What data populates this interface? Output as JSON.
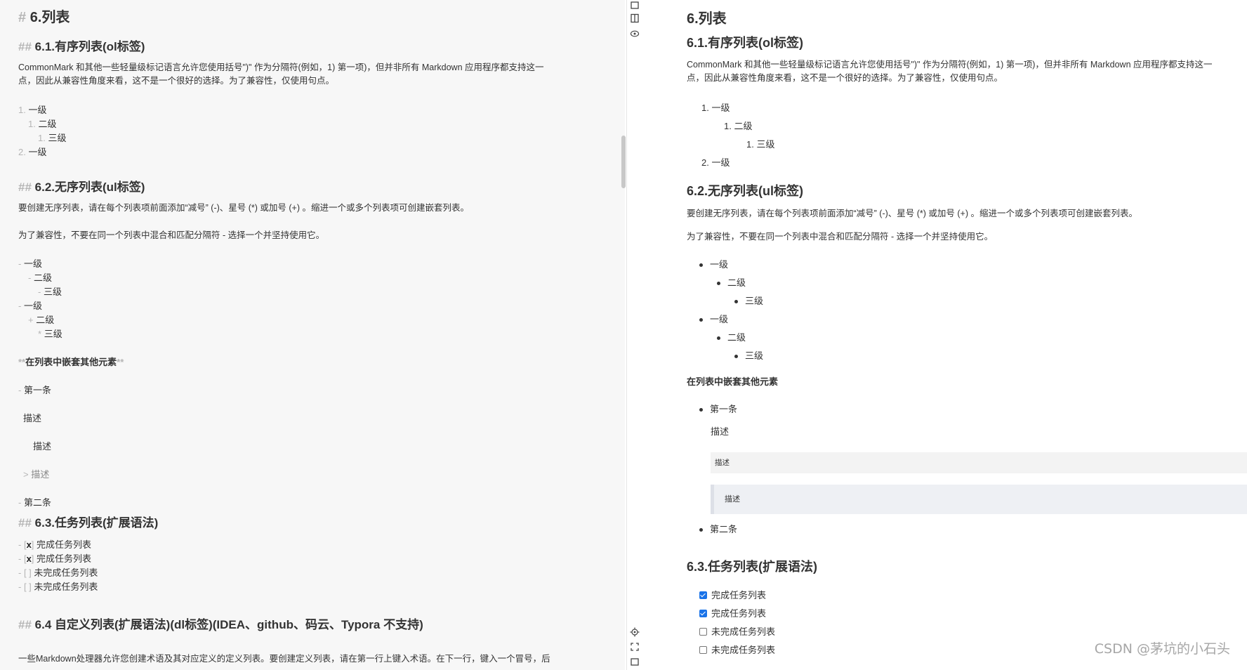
{
  "editor": {
    "h1": {
      "mark": "#",
      "text": "6.列表"
    },
    "h2_ol": {
      "mark": "##",
      "text": "6.1.有序列表(ol标签)"
    },
    "ol_para_1": "CommonMark 和其他一些轻量级标记语言允许您使用括号\")\" 作为分隔符(例如，1) 第一项)，但并非所有 Markdown 应用程序都支持这一",
    "ol_para_2": "点，因此从兼容性角度来看，这不是一个很好的选择。为了兼容性，仅使用句点。",
    "ol_items": [
      {
        "mark": "1.",
        "text": "一级"
      },
      {
        "mark": "1.",
        "text": "二级"
      },
      {
        "mark": "1.",
        "text": "三级"
      },
      {
        "mark": "2.",
        "text": "一级"
      }
    ],
    "h2_ul": {
      "mark": "##",
      "text": "6.2.无序列表(ul标签)"
    },
    "ul_para_1": "要创建无序列表，请在每个列表项前面添加“减号” (-)、星号 (*) 或加号 (+) 。缩进一个或多个列表项可创建嵌套列表。",
    "ul_para_2": "为了兼容性，不要在同一个列表中混合和匹配分隔符 - 选择一个并坚持使用它。",
    "ul_items": [
      {
        "mark": "-",
        "text": "一级"
      },
      {
        "mark": "-",
        "text": "二级"
      },
      {
        "mark": "-",
        "text": "三级"
      },
      {
        "mark": "-",
        "text": "一级"
      },
      {
        "mark": "+",
        "text": "二级"
      },
      {
        "mark": "*",
        "text": "三级"
      }
    ],
    "nested_title": {
      "mark_open": "**",
      "text": "在列表中嵌套其他元素",
      "mark_close": "**"
    },
    "nested_item_1": {
      "mark": "-",
      "text": "第一条"
    },
    "desc_1": "描述",
    "desc_2": "描述",
    "desc_3": {
      "mark": ">",
      "text": "描述"
    },
    "nested_item_2": {
      "mark": "-",
      "text": "第二条"
    },
    "h2_task": {
      "mark": "##",
      "text": "6.3.任务列表(扩展语法)"
    },
    "tasks": [
      {
        "open": "- [",
        "x": "x",
        "close": "]",
        "text": "完成任务列表"
      },
      {
        "open": "- [",
        "x": "x",
        "close": "]",
        "text": "完成任务列表"
      },
      {
        "open": "- [ ]",
        "x": "",
        "close": "",
        "text": "未完成任务列表"
      },
      {
        "open": "- [ ]",
        "x": "",
        "close": "",
        "text": "未完成任务列表"
      }
    ],
    "h2_dl": {
      "mark": "##",
      "text": "6.4 自定义列表(扩展语法)(dl标签)(IDEA、github、码云、Typora 不支持)"
    },
    "dl_para": "一些Markdown处理器允许您创建术语及其对应定义的定义列表。要创建定义列表，请在第一行上键入术语。在下一行，键入一个冒号，后"
  },
  "strip_icons": [
    "editor-only-icon",
    "split-view-icon",
    "preview-icon",
    "locate-icon",
    "fullscreen-icon",
    "bottom-panel-icon"
  ],
  "preview": {
    "h1": "6.列表",
    "h2_ol": "6.1.有序列表(ol标签)",
    "ol_para_1": "CommonMark 和其他一些轻量级标记语言允许您使用括号\")\" 作为分隔符(例如，1) 第一项)，但并非所有 Markdown 应用程序都支持这一",
    "ol_para_2": "点，因此从兼容性角度来看，这不是一个很好的选择。为了兼容性，仅使用句点。",
    "ol_items": [
      {
        "num": "1.",
        "text": "一级"
      },
      {
        "num": "1.",
        "text": "二级"
      },
      {
        "num": "1.",
        "text": "三级"
      },
      {
        "num": "2.",
        "text": "一级"
      }
    ],
    "h2_ul": "6.2.无序列表(ul标签)",
    "ul_para_1": "要创建无序列表，请在每个列表项前面添加“减号” (-)、星号 (*) 或加号 (+) 。缩进一个或多个列表项可创建嵌套列表。",
    "ul_para_2": "为了兼容性，不要在同一个列表中混合和匹配分隔符 - 选择一个并坚持使用它。",
    "ul_items": [
      "一级",
      "二级",
      "三级",
      "一级",
      "二级",
      "三级"
    ],
    "nested_title": "在列表中嵌套其他元素",
    "nested_item_1": "第一条",
    "desc_1": "描述",
    "code_desc": "描述",
    "quote_desc": "描述",
    "nested_item_2": "第二条",
    "h2_task": "6.3.任务列表(扩展语法)",
    "tasks": [
      {
        "checked": true,
        "text": "完成任务列表"
      },
      {
        "checked": true,
        "text": "完成任务列表"
      },
      {
        "checked": false,
        "text": "未完成任务列表"
      },
      {
        "checked": false,
        "text": "未完成任务列表"
      }
    ],
    "task_accent_color": "#1a73e8"
  },
  "watermark": "CSDN @茅坑的小石头"
}
